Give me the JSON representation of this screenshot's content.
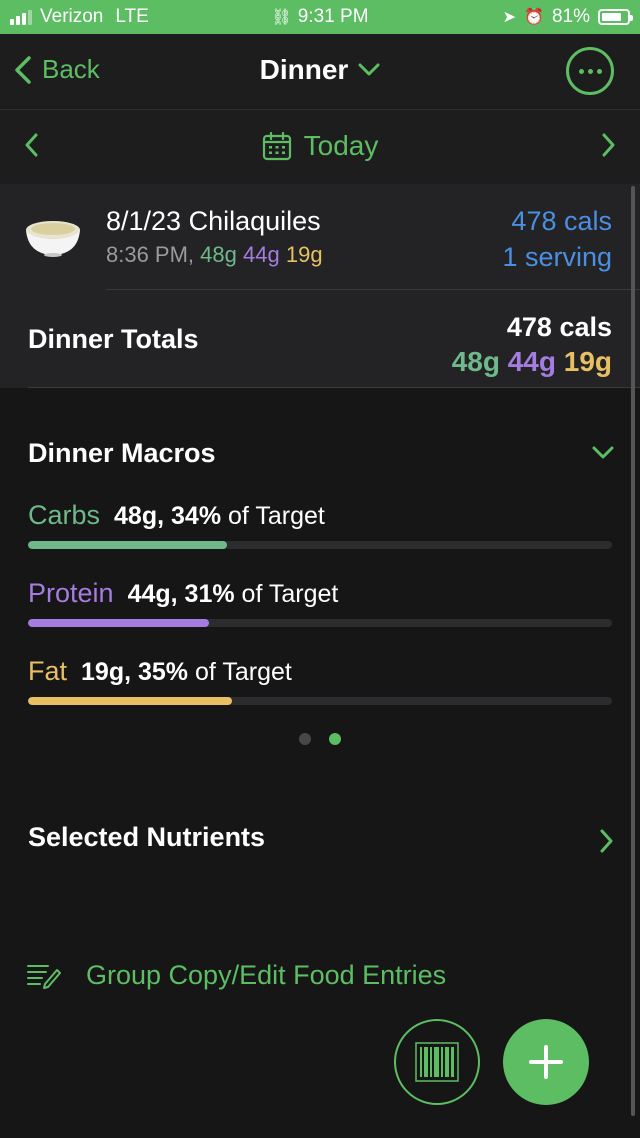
{
  "status_bar": {
    "carrier": "Verizon",
    "network": "LTE",
    "time": "9:31 PM",
    "battery": "81%",
    "battery_level": 0.81
  },
  "nav": {
    "back_label": "Back",
    "title": "Dinner"
  },
  "date_bar": {
    "label": "Today"
  },
  "entry": {
    "name": "8/1/23 Chilaquiles",
    "time": "8:36 PM,",
    "carbs": "48g",
    "protein": "44g",
    "fat": "19g",
    "cals": "478 cals",
    "serving": "1 serving"
  },
  "totals": {
    "label": "Dinner Totals",
    "cals": "478 cals",
    "carbs": "48g",
    "protein": "44g",
    "fat": "19g"
  },
  "macros": {
    "title": "Dinner Macros",
    "items": [
      {
        "name": "Carbs",
        "grams": "48g,",
        "percent": "34%",
        "suffix": "of Target",
        "fraction": 0.34
      },
      {
        "name": "Protein",
        "grams": "44g,",
        "percent": "31%",
        "suffix": "of Target",
        "fraction": 0.31
      },
      {
        "name": "Fat",
        "grams": "19g,",
        "percent": "35%",
        "suffix": "of Target",
        "fraction": 0.35
      }
    ],
    "page_count": 2,
    "active_page": 2
  },
  "nutrients": {
    "title": "Selected Nutrients"
  },
  "group_copy": {
    "label": "Group Copy/Edit Food Entries"
  },
  "colors": {
    "accent": "#5cbd63",
    "carbs": "#6fb88b",
    "protein": "#a57ce0",
    "fat": "#e8c063",
    "cals": "#4a90e2"
  }
}
